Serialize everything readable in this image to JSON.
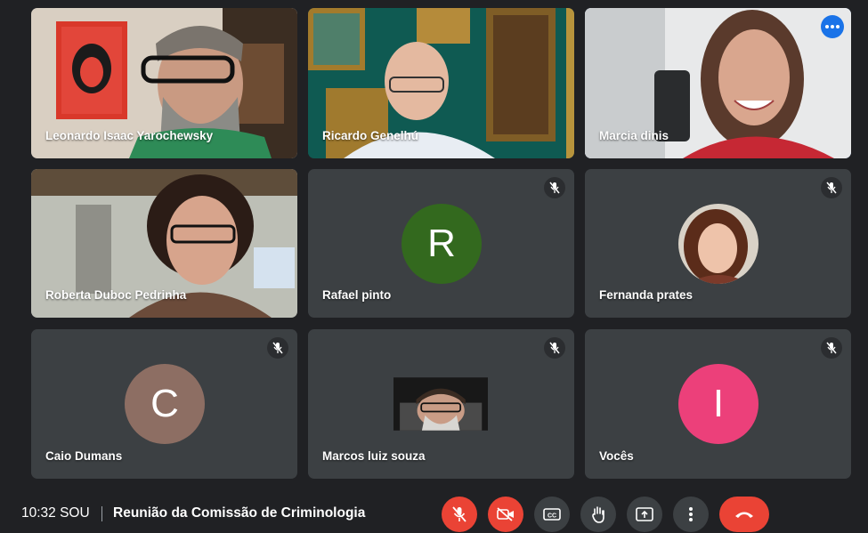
{
  "participants": [
    {
      "name": "Leonardo Isaac Yarochewsky",
      "avatar_letter": "",
      "avatar_color": ""
    },
    {
      "name": "Ricardo Genelhú",
      "avatar_letter": "",
      "avatar_color": ""
    },
    {
      "name": "Marcia dinis",
      "avatar_letter": "",
      "avatar_color": ""
    },
    {
      "name": "Roberta Duboc Pedrinha",
      "avatar_letter": "",
      "avatar_color": ""
    },
    {
      "name": "Rafael pinto",
      "avatar_letter": "R",
      "avatar_color": "#33691e"
    },
    {
      "name": "Fernanda prates",
      "avatar_letter": "",
      "avatar_color": ""
    },
    {
      "name": "Caio Dumans",
      "avatar_letter": "C",
      "avatar_color": "#8d6e63"
    },
    {
      "name": "Marcos luiz souza",
      "avatar_letter": "",
      "avatar_color": ""
    },
    {
      "name": "Vocês",
      "avatar_letter": "I",
      "avatar_color": "#ec407a"
    }
  ],
  "meeting": {
    "time": "10:32 SOU",
    "title": "Reunião da Comissão de Criminologia"
  },
  "controls": {
    "mic": "mic-off-icon",
    "camera": "camera-off-icon",
    "captions": "closed-captions-icon",
    "raise_hand": "raise-hand-icon",
    "present": "present-screen-icon",
    "more": "more-options-icon",
    "leave": "leave-call-icon"
  },
  "colors": {
    "background": "#202124",
    "tile": "#3c4043",
    "active_outline": "#8ab4f8",
    "danger": "#ea4335"
  }
}
